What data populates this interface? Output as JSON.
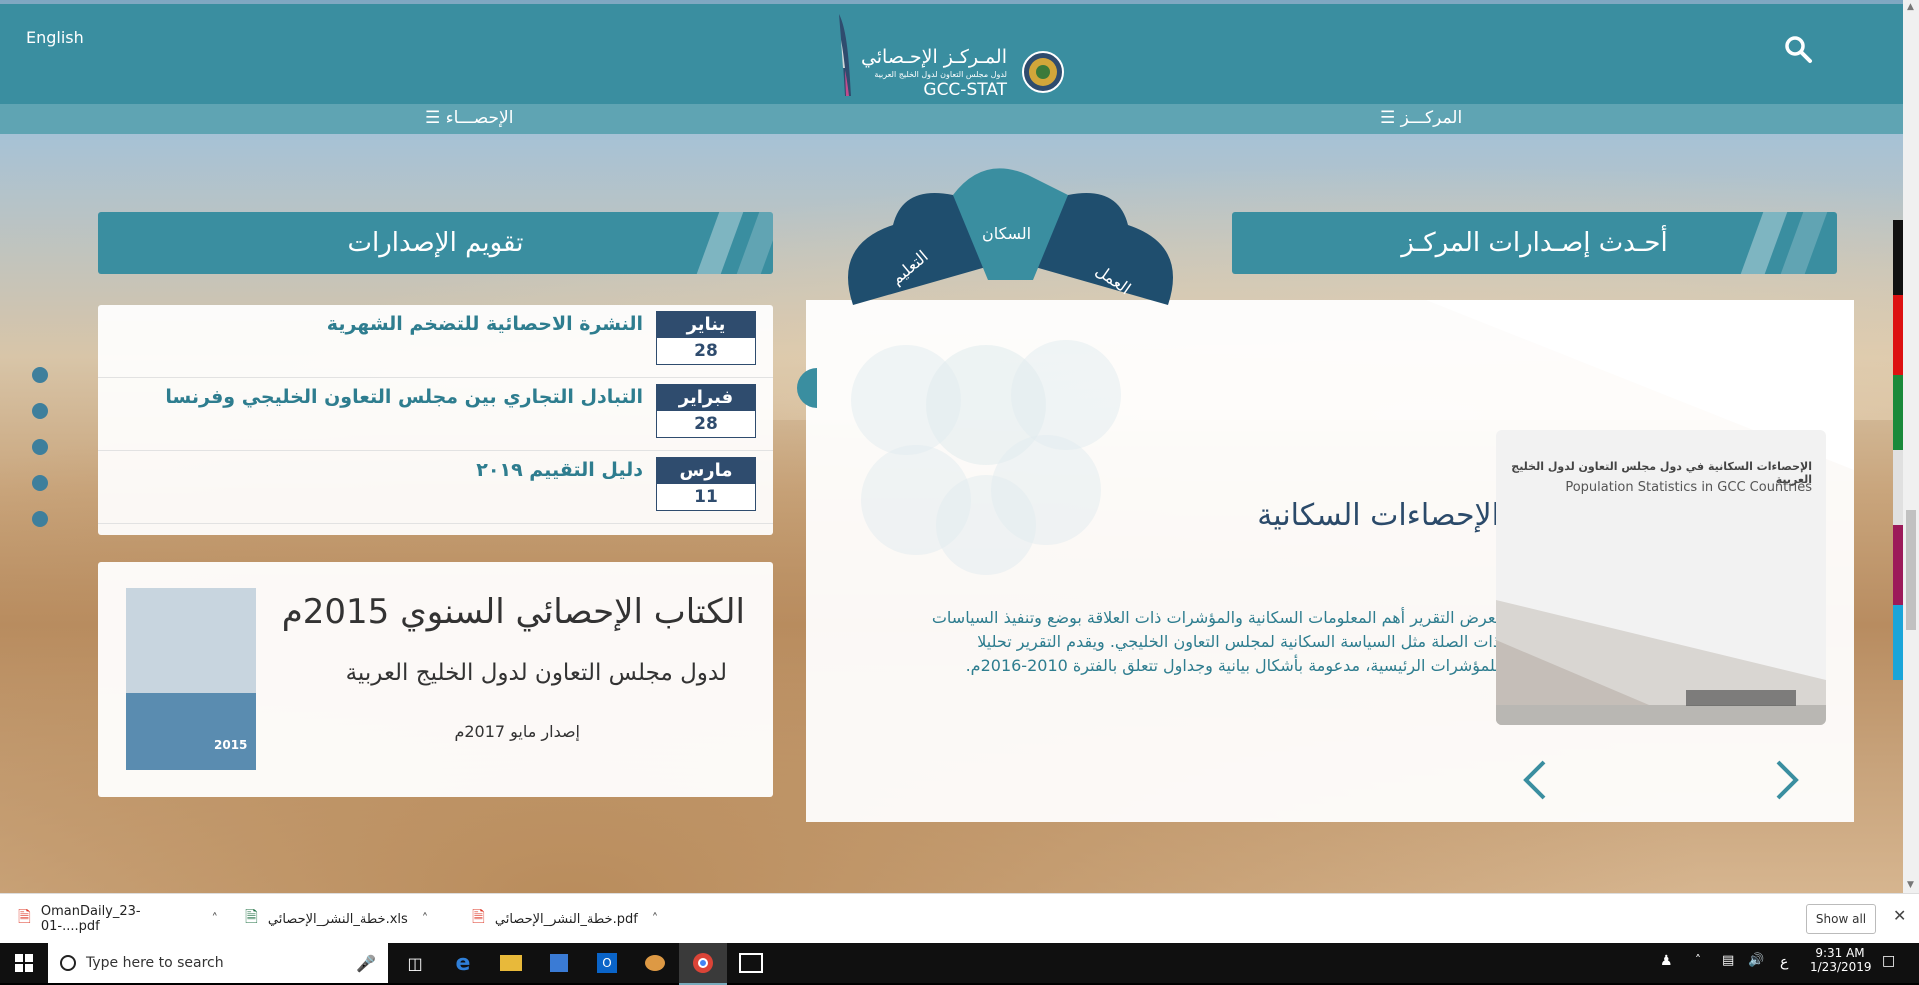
{
  "site": {
    "lang_link": "English",
    "logo_ar_title": "المـركـز الإحـصائي",
    "logo_ar_sub": "لدول مجلس التعاون لدول الخليج العربية",
    "logo_en": "GCC-STAT"
  },
  "nav": {
    "center_label": "المركـــز",
    "stats_label": "الإحصـــاء"
  },
  "latest": {
    "header": "أحـدث إصـدارات المركـز",
    "wheel": {
      "center": "السكان",
      "left": "التعليم",
      "right": "العمل"
    },
    "title": "الإحصاءات السكانية",
    "body": "يعرض التقرير أهم المعلومات السكانية والمؤشرات ذات العلاقة بوضع وتنفيذ السياسات ذات الصلة مثل السياسة السكانية لمجلس التعاون الخليجي. ويقدم التقرير تحليلا للمؤشرات الرئيسية، مدعومة بأشكال بيانية وجداول تتعلق بالفترة 2010-2016م.",
    "cover_ar": "الإحصاءات السكانية في دول مجلس التعاون لدول الخليج العربية",
    "cover_en": "Population Statistics in GCC Countries"
  },
  "calendar": {
    "header": "تقويم الإصدارات",
    "items": [
      {
        "month": "يناير",
        "day": "28",
        "title": "النشرة الاحصائية للتضخم الشهرية"
      },
      {
        "month": "فبراير",
        "day": "28",
        "title": "التبادل التجاري بين مجلس التعاون الخليجي وفرنسا"
      },
      {
        "month": "مارس",
        "day": "11",
        "title": "دليل التقييم ٢٠١٩"
      }
    ]
  },
  "yearbook": {
    "title": "الكتاب الإحصائي السنوي 2015م",
    "subtitle": "لدول مجلس التعاون لدول الخليج العربية",
    "release": "إصدار مايو 2017م",
    "cover_year": "2015"
  },
  "downloads": {
    "items": [
      {
        "name": "OmanDaily_23-01-....pdf"
      },
      {
        "name": "خطة_النشر_الإحصائي.xls"
      },
      {
        "name": "خطة_النشر_الإحصائي.pdf"
      }
    ],
    "show_all": "Show all"
  },
  "taskbar": {
    "search_placeholder": "Type here to search",
    "time": "9:31 AM",
    "date": "1/23/2019",
    "lang": "ع"
  },
  "colors": {
    "brand_teal": "#3a8ea0",
    "dark_navy": "#2f4c6e",
    "link_teal": "#2e7d8f"
  }
}
